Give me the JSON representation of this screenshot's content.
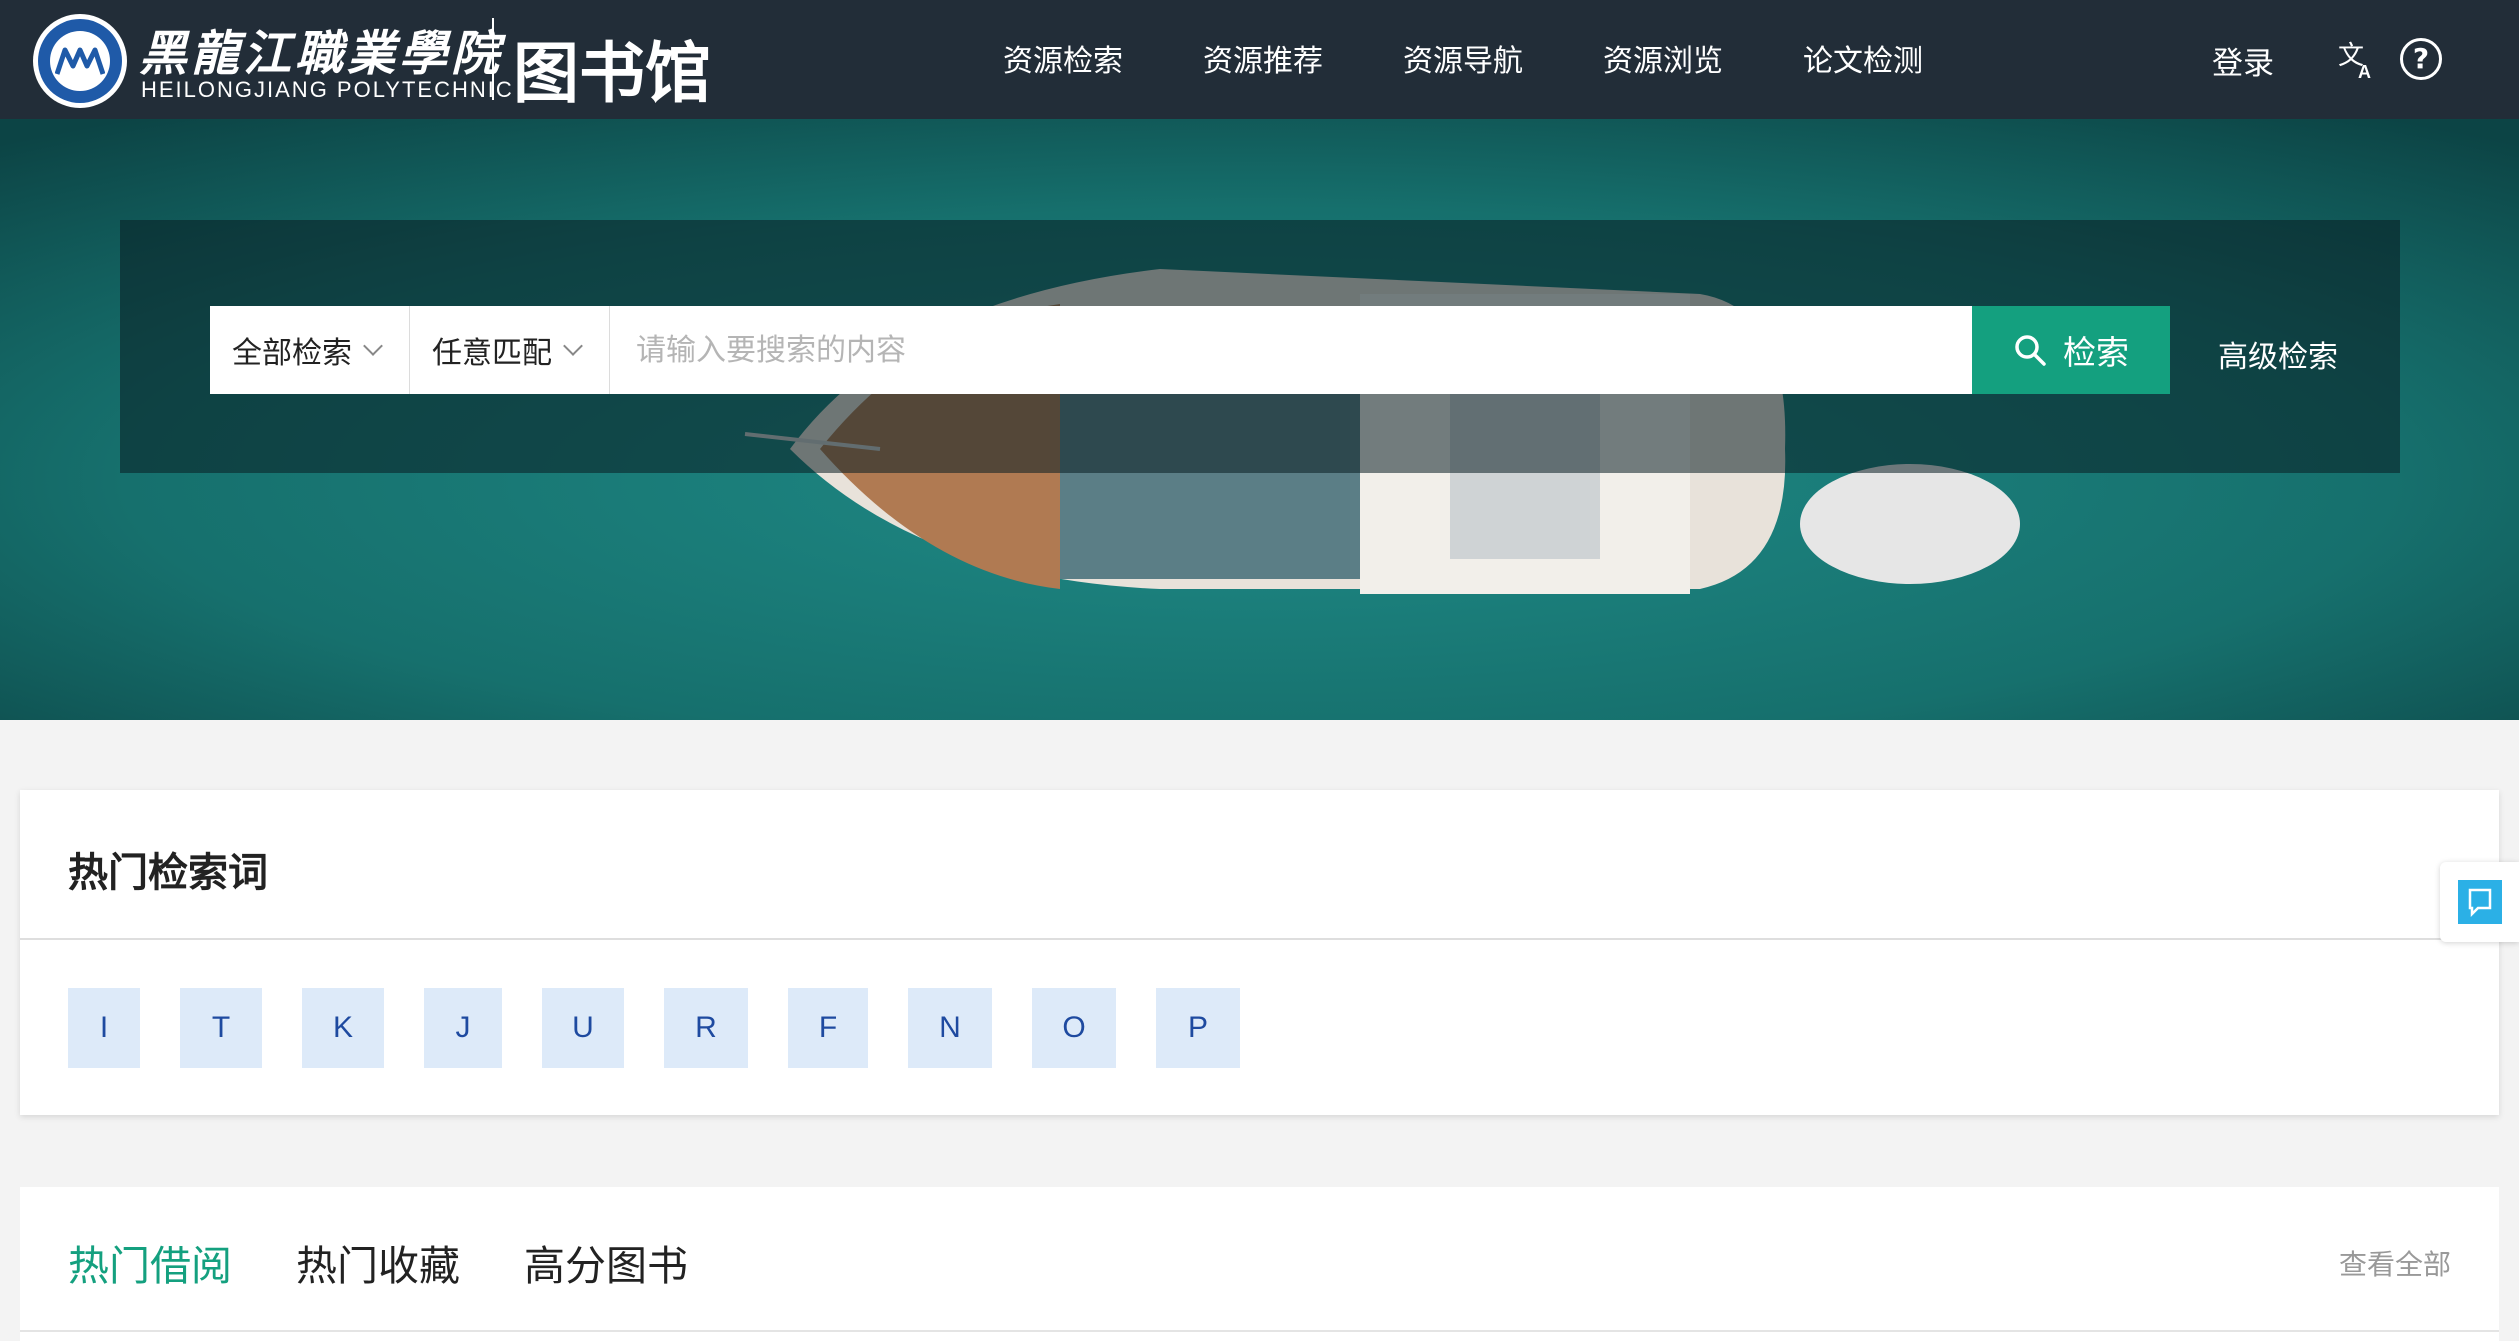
{
  "header": {
    "school_name_cn": "黑龍江職業學院",
    "school_name_en": "HEILONGJIANG POLYTECHNIC",
    "library_title": "图书馆",
    "logo_icon": "school-emblem-icon",
    "nav": [
      {
        "label": "资源检索"
      },
      {
        "label": "资源推荐"
      },
      {
        "label": "资源导航"
      },
      {
        "label": "资源浏览"
      },
      {
        "label": "论文检测"
      }
    ],
    "login_label": "登录",
    "language_icon": "translate-icon",
    "help_icon": "help-icon",
    "help_glyph": "?"
  },
  "search": {
    "scope_value": "全部检索",
    "match_value": "任意匹配",
    "placeholder": "请输入要搜索的内容",
    "button_label": "检索",
    "advanced_label": "高级检索"
  },
  "hot_words": {
    "title": "热门检索词",
    "tags": [
      "I",
      "T",
      "K",
      "J",
      "U",
      "R",
      "F",
      "N",
      "O",
      "P"
    ]
  },
  "book_tabs": {
    "tabs": [
      {
        "label": "热门借阅",
        "active": true
      },
      {
        "label": "热门收藏",
        "active": false
      },
      {
        "label": "高分图书",
        "active": false
      }
    ],
    "view_all_label": "查看全部"
  },
  "colors": {
    "header_bg": "#222d38",
    "accent": "#14a07f",
    "tag_bg": "#ddeaf9",
    "tag_text": "#1e4aa0"
  }
}
